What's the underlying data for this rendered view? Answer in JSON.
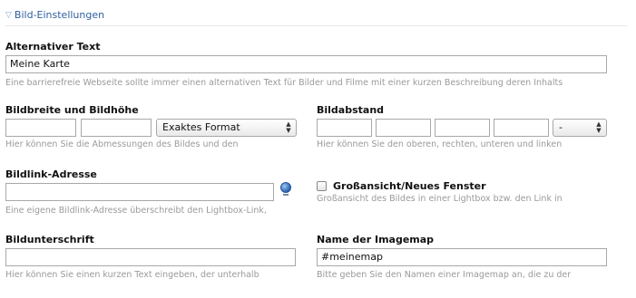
{
  "section": {
    "toggle_icon": "triangle-down-icon",
    "title": "Bild-Einstellungen"
  },
  "alt_text": {
    "label": "Alternativer Text",
    "value": "Meine Karte",
    "help": "Eine barrierefreie Webseite sollte immer einen alternativen Text für Bilder und Filme mit einer kurzen Beschreibung deren Inhalts"
  },
  "size": {
    "label": "Bildbreite und Bildhöhe",
    "width_value": "",
    "height_value": "",
    "mode_selected": "Exaktes Format",
    "help": "Hier können Sie die Abmessungen des Bildes und den"
  },
  "margin": {
    "label": "Bildabstand",
    "top": "",
    "right": "",
    "bottom": "",
    "left": "",
    "unit_selected": "-",
    "help": "Hier können Sie den oberen, rechten, unteren und linken"
  },
  "link": {
    "label": "Bildlink-Adresse",
    "value": "",
    "picker_icon": "globe-icon",
    "help": "Eine eigene Bildlink-Adresse überschreibt den Lightbox-Link,"
  },
  "fullsize": {
    "label": "Großansicht/Neues Fenster",
    "checked": false,
    "help": "Großansicht des Bildes in einer Lightbox bzw. den Link in"
  },
  "caption": {
    "label": "Bildunterschrift",
    "value": "",
    "help": "Hier können Sie einen kurzen Text eingeben, der unterhalb"
  },
  "imagemap": {
    "label": "Name der Imagemap",
    "value": "#meinemap",
    "help": "Bitte geben Sie den Namen einer Imagemap an, die zu der"
  }
}
